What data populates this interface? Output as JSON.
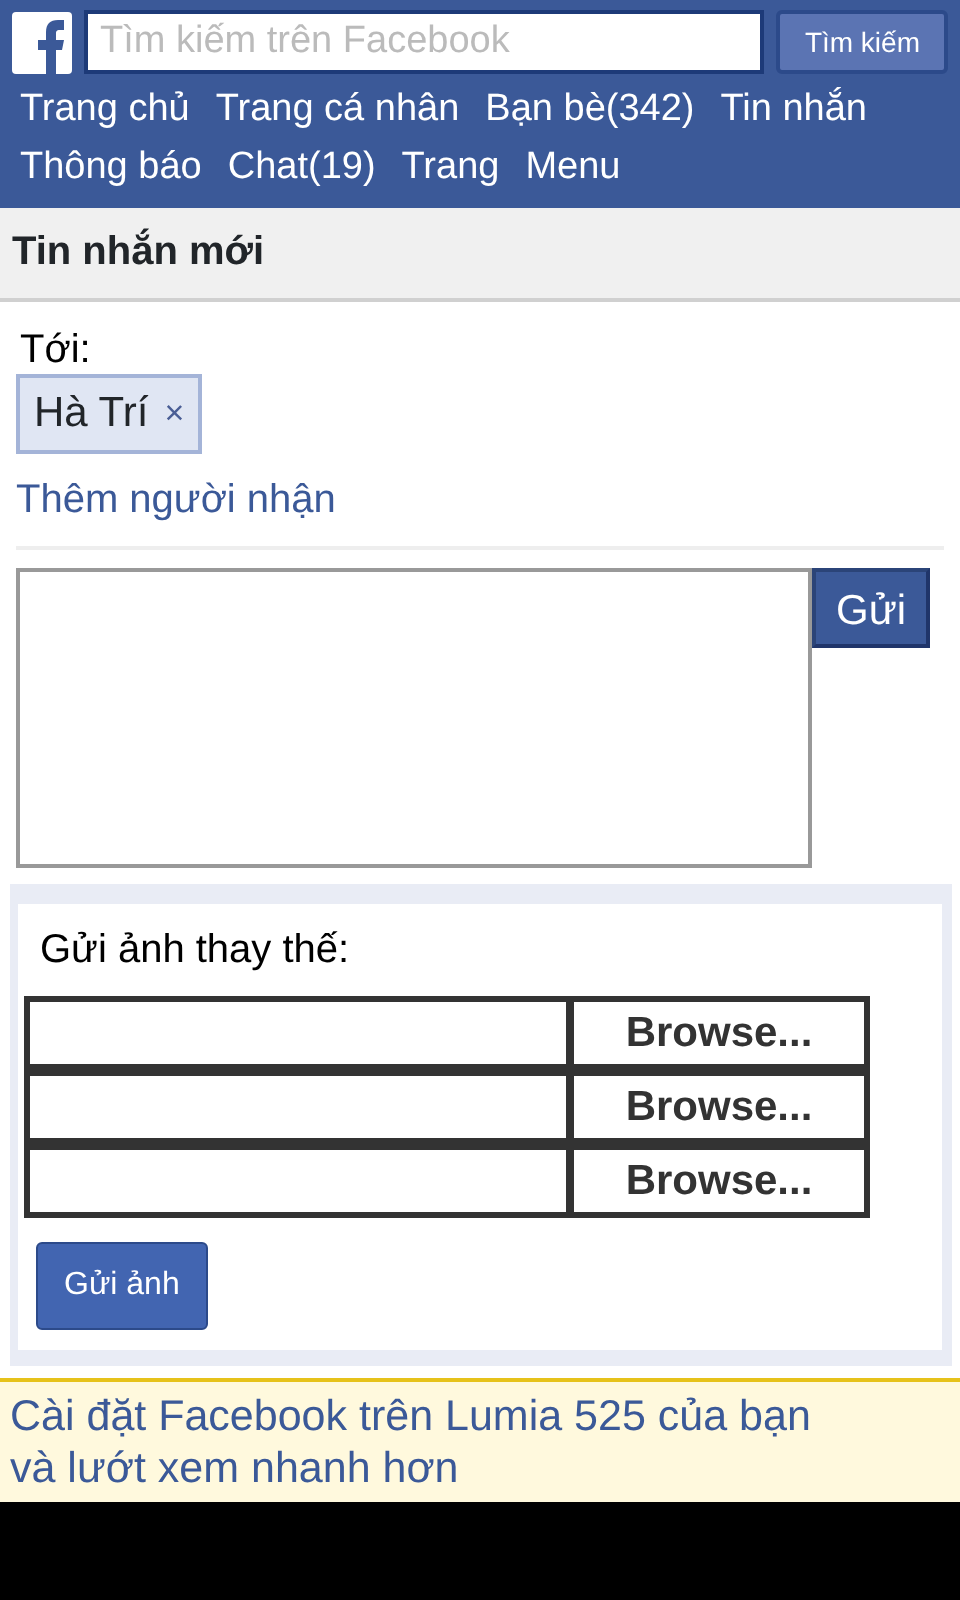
{
  "header": {
    "search": {
      "placeholder": "Tìm kiếm trên Facebook"
    },
    "search_button": "Tìm kiếm",
    "nav": [
      "Trang chủ",
      "Trang cá nhân",
      "Bạn bè(342)",
      "Tin nhắn",
      "Thông báo",
      "Chat(19)",
      "Trang",
      "Menu"
    ]
  },
  "page_title": "Tin nhắn mới",
  "compose": {
    "to_label": "Tới:",
    "recipients": [
      {
        "name": "Hà Trí",
        "remove": "×"
      }
    ],
    "add_recipient": "Thêm người nhận",
    "send_button": "Gửi"
  },
  "photos": {
    "label": "Gửi ảnh thay thế:",
    "files": [
      {
        "button": "Browse..."
      },
      {
        "button": "Browse..."
      },
      {
        "button": "Browse..."
      }
    ],
    "send_button": "Gửi ảnh"
  },
  "banner": {
    "lines": [
      "Cài đặt Facebook trên Lumia 525 của bạn",
      "và lướt xem nhanh hơn"
    ]
  }
}
